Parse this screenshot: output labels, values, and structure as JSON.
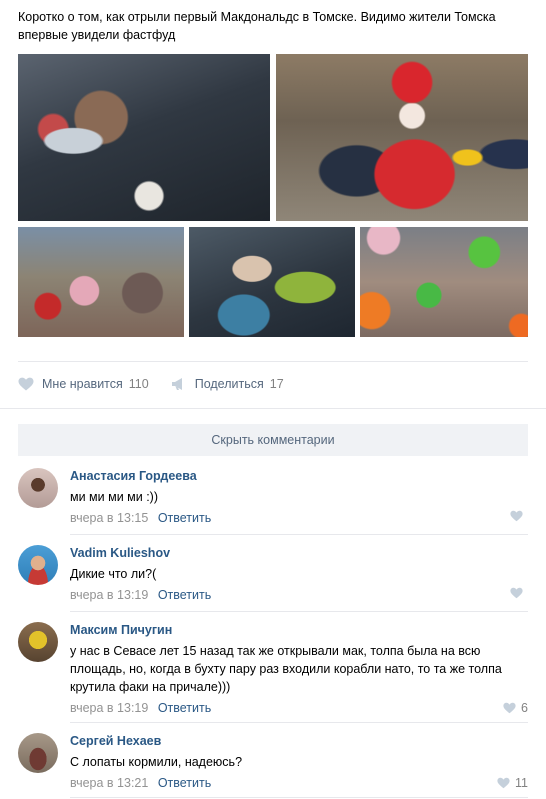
{
  "post": {
    "text": "Коротко о том, как отрыли первый Макдональдс в Томске. Видимо жители Томска впервые увидели фастфуд"
  },
  "actions": {
    "like_label": "Мне нравится",
    "like_count": "110",
    "share_label": "Поделиться",
    "share_count": "17"
  },
  "hide_comments_label": "Скрыть комментарии",
  "comments": [
    {
      "author": "Анастасия Гордеева",
      "text": "ми ми ми ми :))",
      "time": "вчера в 13:15",
      "reply": "Ответить",
      "likes": ""
    },
    {
      "author": "Vadim Kulieshov",
      "text": "Дикие что ли?(",
      "time": "вчера в 13:19",
      "reply": "Ответить",
      "likes": ""
    },
    {
      "author": "Максим Пичугин",
      "text": "у нас в Севасе лет 15 назад так же открывали мак, толпа была на всю площадь, но, когда в бухту пару раз входили корабли нато, то та же толпа крутила факи на причале)))",
      "time": "вчера в 13:19",
      "reply": "Ответить",
      "likes": "6"
    },
    {
      "author": "Сергей Нехаев",
      "text": "С лопаты кормили, надеюсь?",
      "time": "вчера в 13:21",
      "reply": "Ответить",
      "likes": "11"
    }
  ],
  "colors": {
    "link": "#2a5885",
    "muted": "#939393",
    "bar": "#f0f2f5"
  }
}
